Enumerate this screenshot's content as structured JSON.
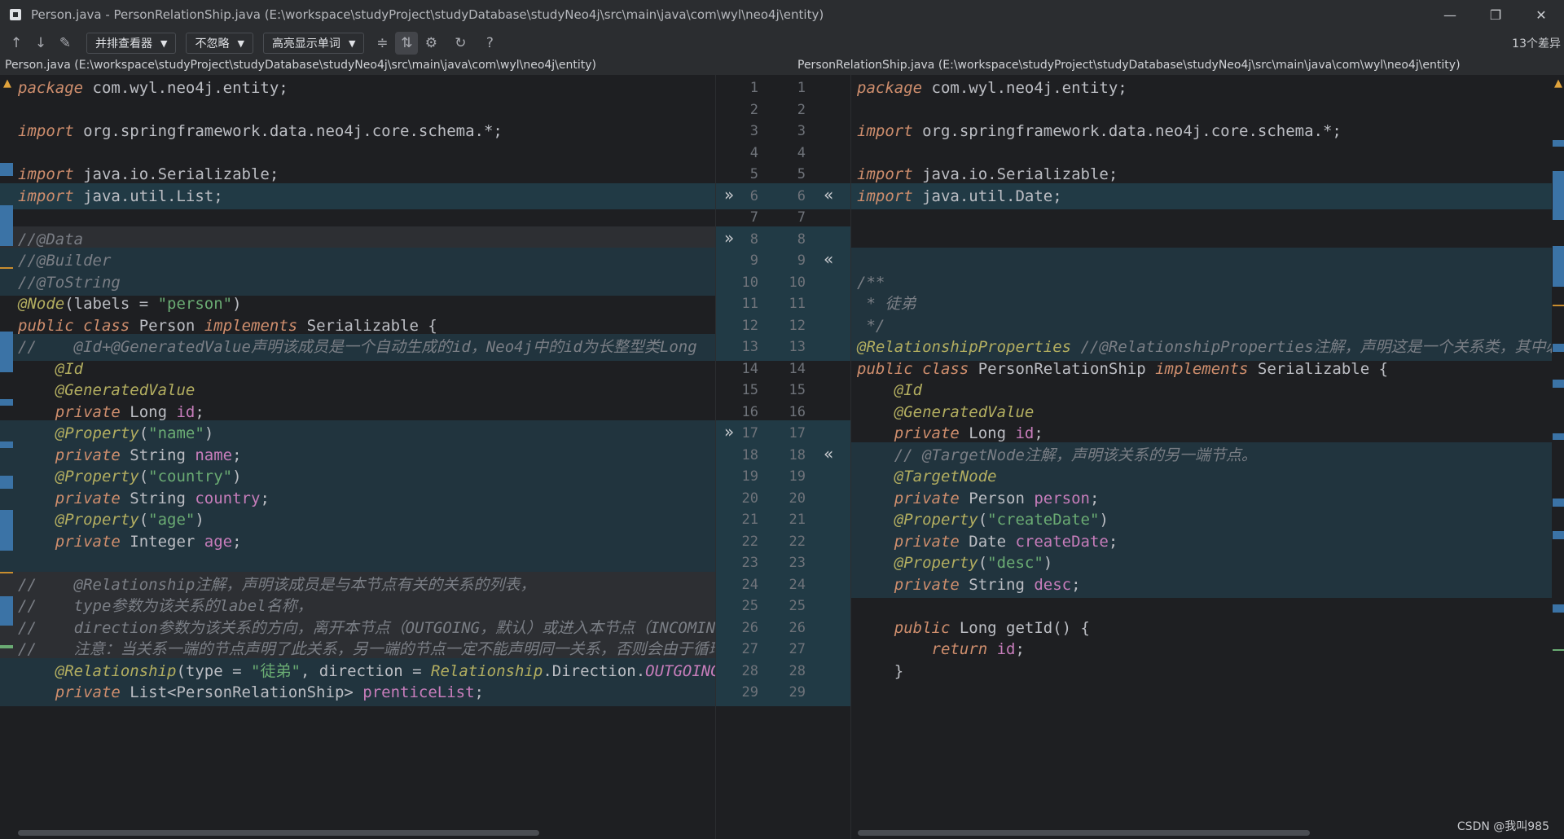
{
  "window": {
    "title": "Person.java - PersonRelationShip.java (E:\\workspace\\studyProject\\studyDatabase\\studyNeo4j\\src\\main\\java\\com\\wyl\\neo4j\\entity)",
    "minimize": "—",
    "restore": "❐",
    "close": "✕"
  },
  "toolbar": {
    "prev_icon": "↑",
    "next_icon": "↓",
    "edit_icon": "✎",
    "viewer_label": "并排查看器",
    "ignore_label": "不忽略",
    "highlight_label": "高亮显示单词",
    "collapse_icon": "≑",
    "sync_icon": "⇅",
    "settings_icon": "⚙",
    "refresh_icon": "↻",
    "help_icon": "?",
    "caret": "▼",
    "diff_count": "13个差异"
  },
  "files": {
    "left": "Person.java (E:\\workspace\\studyProject\\studyDatabase\\studyNeo4j\\src\\main\\java\\com\\wyl\\neo4j\\entity)",
    "right": "PersonRelationShip.java (E:\\workspace\\studyProject\\studyDatabase\\studyNeo4j\\src\\main\\java\\com\\wyl\\neo4j\\entity)"
  },
  "gutter": {
    "left_numbers": [
      "1",
      "2",
      "3",
      "4",
      "5",
      "6",
      "7",
      "8",
      "9",
      "10",
      "11",
      "12",
      "13",
      "14",
      "15",
      "16",
      "17",
      "18",
      "19",
      "20",
      "21",
      "22",
      "23",
      "24",
      "25",
      "26",
      "27",
      "28",
      "29"
    ],
    "right_numbers": [
      "1",
      "2",
      "3",
      "4",
      "5",
      "6",
      "7",
      "8",
      "9",
      "10",
      "11",
      "12",
      "13",
      "14",
      "15",
      "16",
      "17",
      "18",
      "19",
      "20",
      "21",
      "22",
      "23",
      "24",
      "25",
      "26",
      "27",
      "28",
      "29"
    ],
    "apply_left_icon": "»",
    "apply_right_icon": "«"
  },
  "left_code": [
    "package com.wyl.neo4j.entity;",
    "",
    "import org.springframework.data.neo4j.core.schema.*;",
    "",
    "import java.io.Serializable;",
    "import java.util.List;",
    "",
    "//@Data",
    "//@Builder",
    "//@ToString",
    "@Node(labels = \"person\")",
    "public class Person implements Serializable {",
    "//    @Id+@GeneratedValue声明该成员是一个自动生成的id，Neo4j中的id为长整型类Long",
    "    @Id",
    "    @GeneratedValue",
    "    private Long id;",
    "    @Property(\"name\")",
    "    private String name;",
    "    @Property(\"country\")",
    "    private String country;",
    "    @Property(\"age\")",
    "    private Integer age;",
    "",
    "//    @Relationship注解，声明该成员是与本节点有关的关系的列表，",
    "//    type参数为该关系的label名称，",
    "//    direction参数为该关系的方向，离开本节点（OUTGOING，默认）或进入本节点（INCOMING）",
    "//    注意：当关系一端的节点声明了此关系，另一端的节点一定不能声明同一关系，否则会由于循环嵌",
    "    @Relationship(type = \"徒弟\", direction = Relationship.Direction.OUTGOING)",
    "    private List<PersonRelationShip> prenticeList;"
  ],
  "right_code": [
    "package com.wyl.neo4j.entity;",
    "",
    "import org.springframework.data.neo4j.core.schema.*;",
    "",
    "import java.io.Serializable;",
    "import java.util.Date;",
    "",
    "",
    "",
    "/**",
    " * 徒弟",
    " */",
    "@RelationshipProperties //@RelationshipProperties注解，声明这是一个关系类，其中必须包",
    "public class PersonRelationShip implements Serializable {",
    "    @Id",
    "    @GeneratedValue",
    "    private Long id;",
    "    // @TargetNode注解，声明该关系的另一端节点。",
    "    @TargetNode",
    "    private Person person;",
    "    @Property(\"createDate\")",
    "    private Date createDate;",
    "    @Property(\"desc\")",
    "    private String desc;",
    "",
    "    public Long getId() {",
    "        return id;",
    "    }",
    ""
  ],
  "watermark": "CSDN @我叫985",
  "colors": {
    "background": "#1e1f22",
    "keyword": "#cf8e6d",
    "annotation": "#b3ae60",
    "string": "#6aab73",
    "field": "#c77dbb",
    "modified_block": "#213a45",
    "warning": "#e0a33c"
  }
}
